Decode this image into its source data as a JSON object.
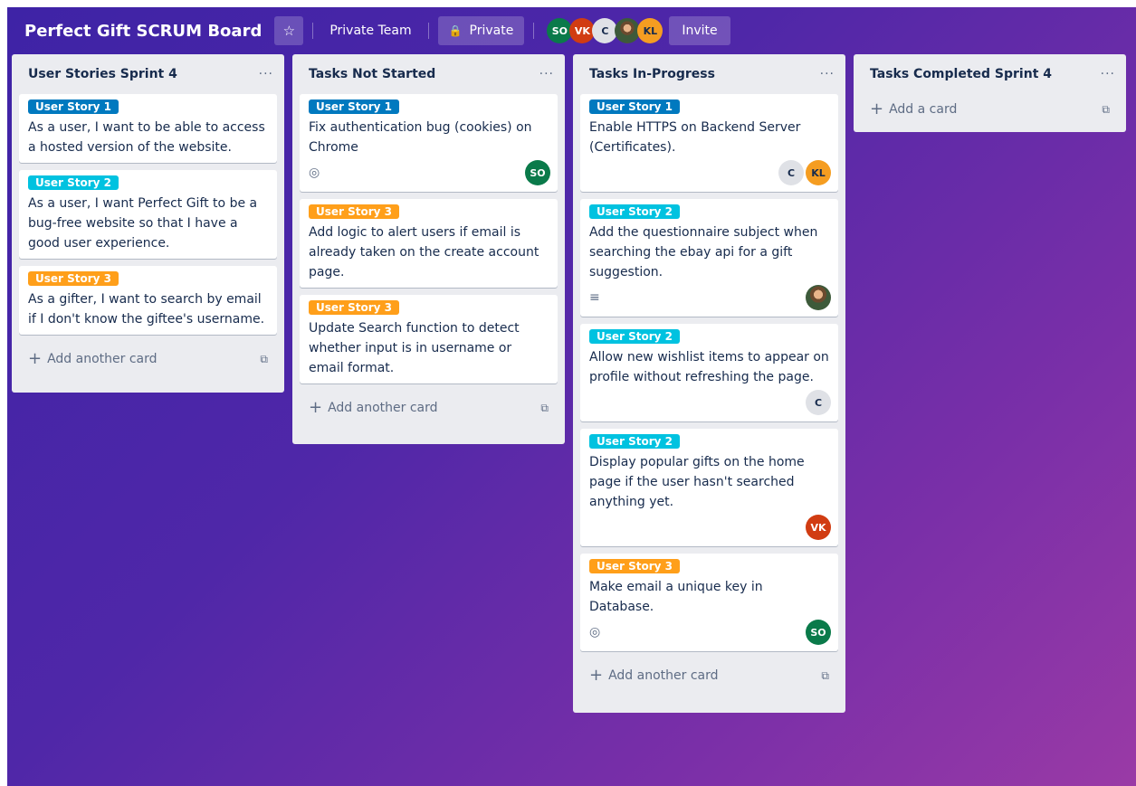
{
  "header": {
    "board_title": "Perfect Gift SCRUM Board",
    "star_icon": "☆",
    "team_label": "Private Team",
    "lock_icon": "🔒",
    "visibility_label": "Private",
    "members": [
      {
        "initials": "SO",
        "color": "#0a7a4a"
      },
      {
        "initials": "VK",
        "color": "#d13c12"
      },
      {
        "initials": "C",
        "color": "#dfe1e6"
      },
      {
        "initials": "",
        "color": "photo"
      },
      {
        "initials": "KL",
        "color": "#f59d21"
      }
    ],
    "invite_label": "Invite"
  },
  "common": {
    "menu_icon": "···",
    "add_another_card": "Add another card",
    "add_a_card": "Add a card",
    "plus_icon": "+",
    "template_icon": "⧉",
    "watch_icon": "◎",
    "description_icon": "≡"
  },
  "lists": [
    {
      "title": "User Stories Sprint 4",
      "cards": [
        {
          "label": "User Story 1",
          "text": "As a user, I want to be able to access a hosted version of the website."
        },
        {
          "label": "User Story 2",
          "text": "As a user, I want Perfect Gift to be a bug-free website so that I have a good user experience."
        },
        {
          "label": "User Story 3",
          "text": "As a gifter, I want to search by email if I don't know the giftee's username."
        }
      ]
    },
    {
      "title": "Tasks Not Started",
      "cards": [
        {
          "label": "User Story 1",
          "text": "Fix authentication bug (cookies) on Chrome",
          "members": [
            "SO"
          ]
        },
        {
          "label": "User Story 3",
          "text": "Add logic to alert users if email is already taken on the create account page."
        },
        {
          "label": "User Story 3",
          "text": "Update Search function to detect whether input is in username or email format."
        }
      ]
    },
    {
      "title": "Tasks In-Progress",
      "cards": [
        {
          "label": "User Story 1",
          "text": "Enable HTTPS on Backend Server (Certificates).",
          "members": [
            "C",
            "KL"
          ]
        },
        {
          "label": "User Story 2",
          "text": "Add the questionnaire subject when searching the ebay api for a gift suggestion."
        },
        {
          "label": "User Story 2",
          "text": "Allow new wishlist items to appear on profile without refreshing the page.",
          "members": [
            "C"
          ]
        },
        {
          "label": "User Story 2",
          "text": "Display popular gifts on the home page if the user hasn't searched anything yet.",
          "members": [
            "VK"
          ]
        },
        {
          "label": "User Story 3",
          "text": "Make email a unique key in Database.",
          "members": [
            "SO"
          ]
        }
      ]
    },
    {
      "title": "Tasks Completed Sprint 4"
    }
  ]
}
